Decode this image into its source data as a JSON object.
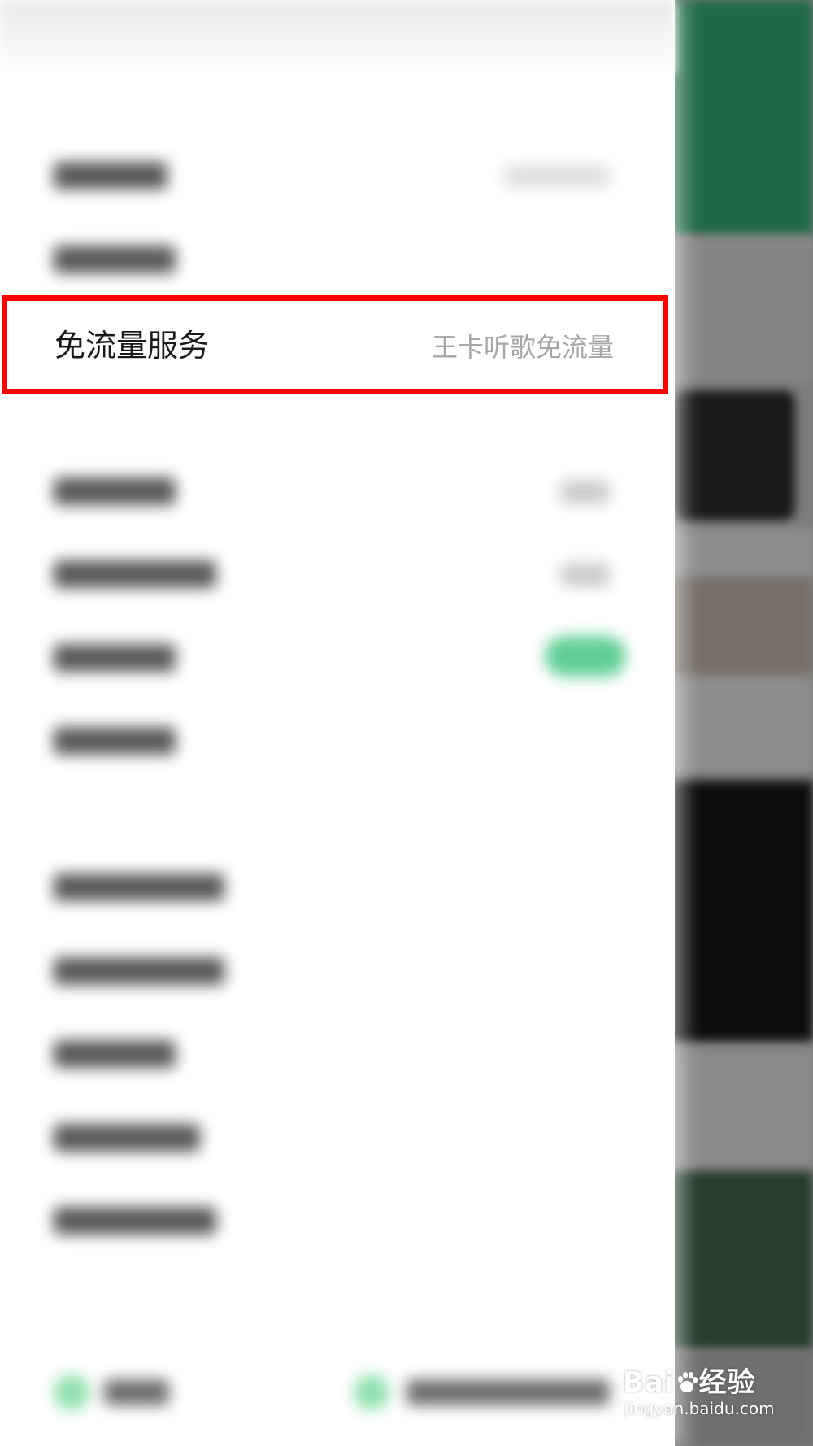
{
  "free_data_row": {
    "label": "免流量服务",
    "value": "王卡听歌免流量"
  },
  "watermark": {
    "brand_left": "Bai",
    "brand_right": "经验",
    "site": "jingyan.baidu.com"
  },
  "colors": {
    "highlight": "#ff0000",
    "toggle_on": "#39c27a",
    "bg_app_green": "#1f6a45"
  },
  "icons": [
    "paw-icon"
  ]
}
